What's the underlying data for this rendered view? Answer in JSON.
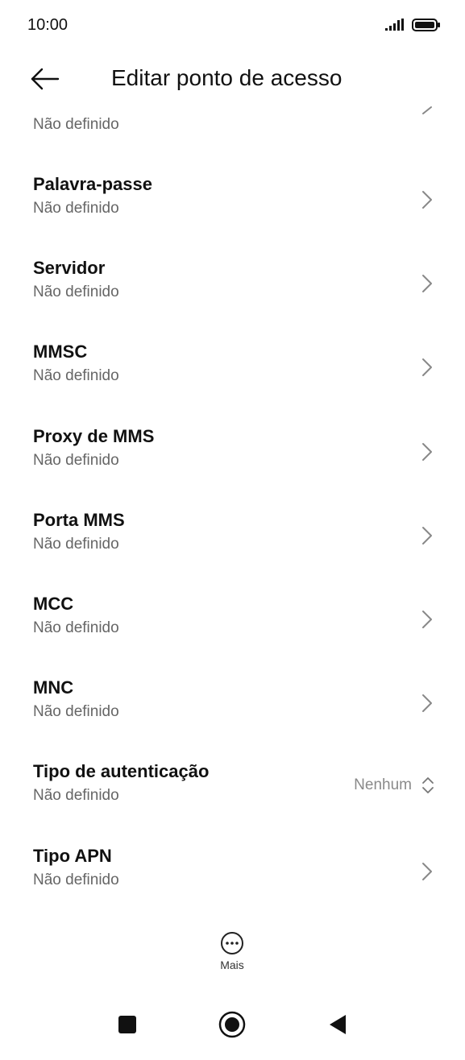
{
  "status": {
    "time": "10:00"
  },
  "header": {
    "title": "Editar ponto de acesso"
  },
  "partial_item": {
    "subtitle": "Não definido"
  },
  "items": [
    {
      "title": "Palavra-passe",
      "subtitle": "Não definido"
    },
    {
      "title": "Servidor",
      "subtitle": "Não definido"
    },
    {
      "title": "MMSC",
      "subtitle": "Não definido"
    },
    {
      "title": "Proxy de MMS",
      "subtitle": "Não definido"
    },
    {
      "title": "Porta MMS",
      "subtitle": "Não definido"
    },
    {
      "title": "MCC",
      "subtitle": "Não definido"
    },
    {
      "title": "MNC",
      "subtitle": "Não definido"
    },
    {
      "title": "Tipo de autenticação",
      "subtitle": "Não definido",
      "value": "Nenhum"
    },
    {
      "title": "Tipo APN",
      "subtitle": "Não definido"
    }
  ],
  "more": {
    "label": "Mais"
  },
  "icons": {
    "signal": "signal-icon",
    "battery": "battery-icon",
    "back": "back-arrow-icon",
    "chevron": "chevron-right-icon",
    "updown": "updown-arrows-icon",
    "more": "more-dots-icon",
    "nav_recent": "square-icon",
    "nav_home": "home-circle-icon",
    "nav_back": "triangle-back-icon"
  }
}
